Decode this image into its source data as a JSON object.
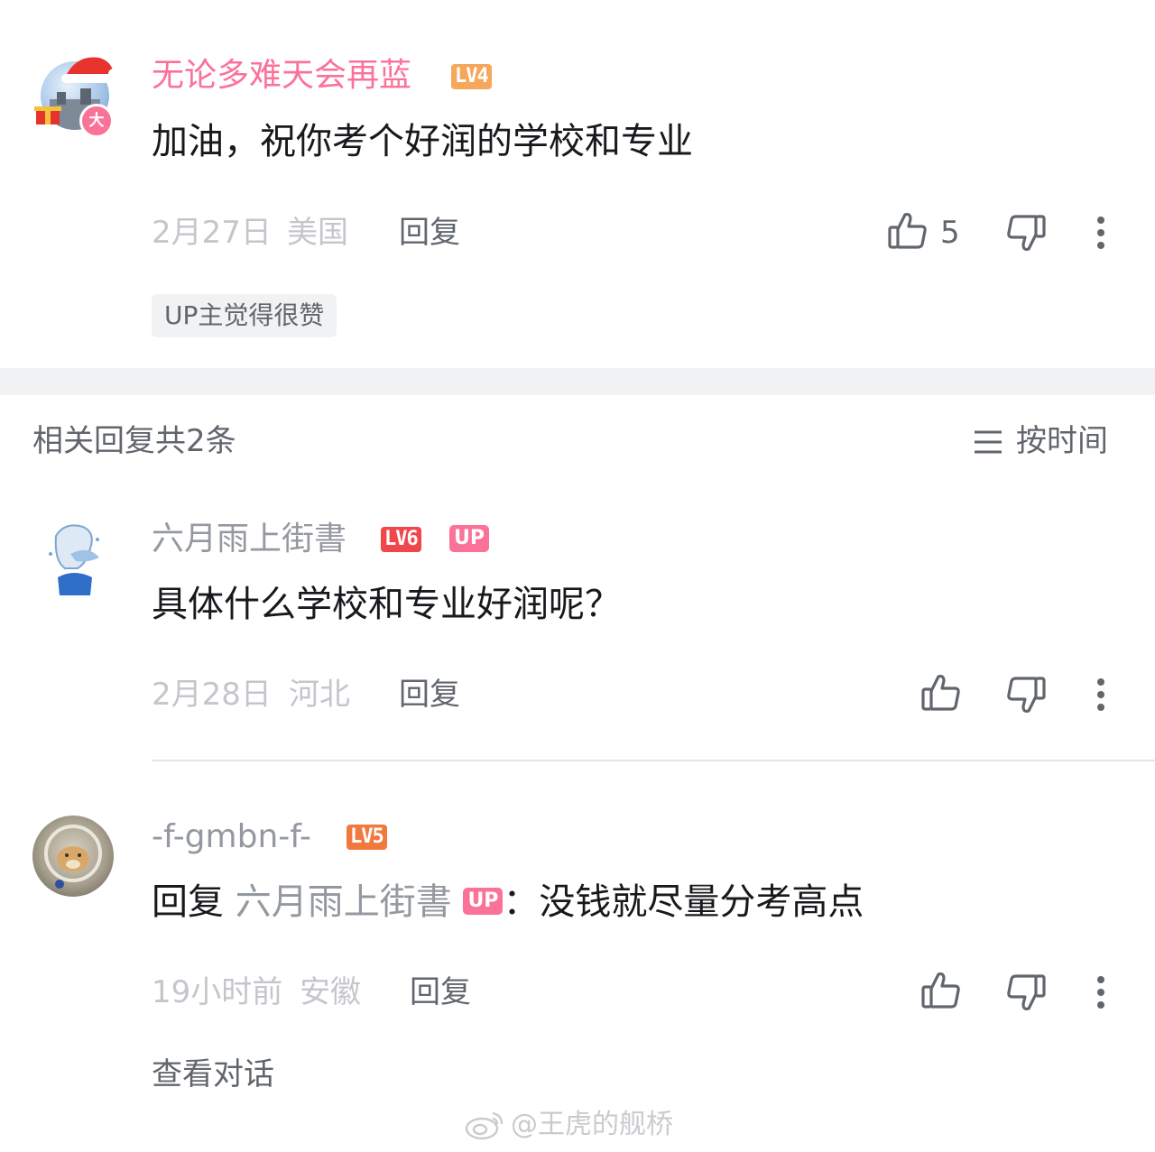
{
  "main_comment": {
    "username": "无论多难天会再蓝",
    "level": "LV4",
    "avatar_badge": "大",
    "content": "加油，祝你考个好润的学校和专业",
    "date": "2月27日",
    "location": "美国",
    "reply_label": "回复",
    "like_count": "5",
    "up_tag": "UP主觉得很赞"
  },
  "replies_header": {
    "title": "相关回复共2条",
    "sort_label": "按时间"
  },
  "replies": [
    {
      "username": "六月雨上街書",
      "level": "LV6",
      "up_badge": "UP",
      "content": "具体什么学校和专业好润呢？",
      "date": "2月28日",
      "location": "河北",
      "reply_label": "回复"
    },
    {
      "username": "-f-gmbn-f-",
      "level": "LV5",
      "content_prefix": "回复",
      "mention": "六月雨上街書",
      "mention_badge": "UP",
      "content": "：没钱就尽量分考高点",
      "date": "19小时前",
      "location": "安徽",
      "reply_label": "回复",
      "view_conversation": "查看对话"
    }
  ],
  "watermark": "@王虎的舰桥",
  "colors": {
    "pink": "#fb7299",
    "lv4": "#f5a75b",
    "lv5": "#f0793e",
    "lv6": "#f0474b",
    "meta_gray": "#c4c6cc",
    "text_gray": "#61666d",
    "separator": "#f1f2f3"
  }
}
